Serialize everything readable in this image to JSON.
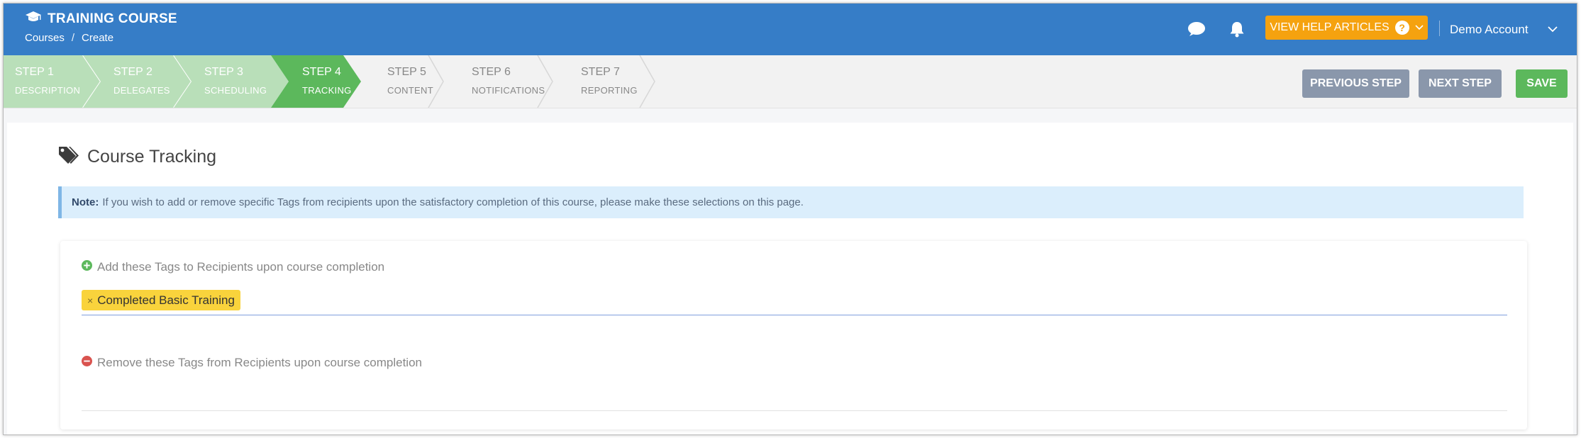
{
  "header": {
    "title": "TRAINING COURSE",
    "breadcrumb": [
      "Courses",
      "/",
      "Create"
    ],
    "help_button": "VIEW HELP ARTICLES",
    "help_glyph": "?",
    "account": "Demo Account"
  },
  "steps": [
    {
      "num": "STEP 1",
      "label": "DESCRIPTION",
      "state": "done"
    },
    {
      "num": "STEP 2",
      "label": "DELEGATES",
      "state": "done"
    },
    {
      "num": "STEP 3",
      "label": "SCHEDULING",
      "state": "done"
    },
    {
      "num": "STEP 4",
      "label": "TRACKING",
      "state": "active"
    },
    {
      "num": "STEP 5",
      "label": "CONTENT",
      "state": "todo"
    },
    {
      "num": "STEP 6",
      "label": "NOTIFICATIONS",
      "state": "todo"
    },
    {
      "num": "STEP 7",
      "label": "REPORTING",
      "state": "todo"
    }
  ],
  "actions": {
    "previous": "PREVIOUS STEP",
    "next": "NEXT STEP",
    "save": "SAVE"
  },
  "page": {
    "title": "Course Tracking",
    "note_label": "Note:",
    "note_text": "If you wish to add or remove specific Tags from recipients upon the satisfactory completion of this course, please make these selections on this page."
  },
  "tracking": {
    "add_label": "Add these Tags to Recipients upon course completion",
    "add_tags": [
      {
        "remove_glyph": "×",
        "label": "Completed Basic Training"
      }
    ],
    "remove_label": "Remove these Tags from Recipients upon course completion",
    "remove_tags": []
  },
  "colors": {
    "header_blue": "#367dc7",
    "help_orange": "#f5a20f",
    "step_done": "#b9dfb9",
    "step_active": "#5cb85c",
    "button_grey": "#8a97ab",
    "save_green": "#5cb85c",
    "tag_yellow": "#f9d33c",
    "note_blue": "#dbeefc"
  },
  "icons": {
    "brand": "graduation-cap-icon",
    "chat": "chat-bubble-icon",
    "notifications": "bell-icon",
    "section": "tags-icon",
    "add": "plus-circle-icon",
    "remove": "minus-circle-icon"
  }
}
